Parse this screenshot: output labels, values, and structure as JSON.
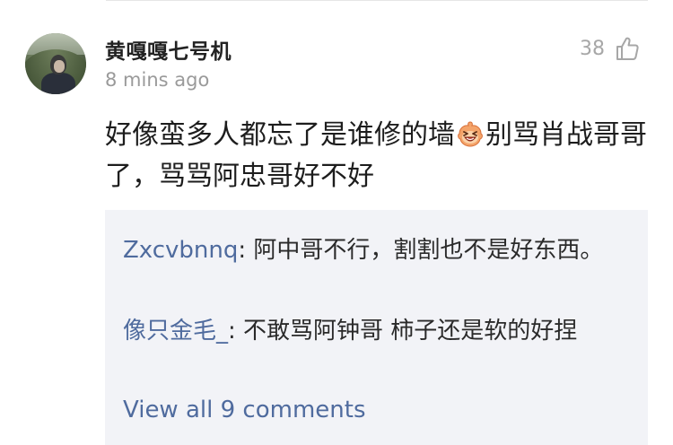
{
  "comment": {
    "username": "黄嘎嘎七号机",
    "time": "8 mins ago",
    "likes": "38",
    "text_before_emoji": "好像蛮多人都忘了是谁修的墙",
    "emoji": "laughing-emoji",
    "text_after_emoji": "别骂肖战哥哥了，骂骂阿忠哥好不好"
  },
  "replies": [
    {
      "author": "Zxcvbnnq",
      "separator": ": ",
      "text": "阿中哥不行，割割也不是好东西。"
    },
    {
      "author": "像只金毛_",
      "separator": ": ",
      "text": "不敢骂阿钟哥 柿子还是软的好捏"
    }
  ],
  "view_all": "View all 9 comments",
  "colors": {
    "link": "#4f6b9e",
    "reply_bg": "#f2f3f7",
    "muted": "#9a9a9a"
  }
}
